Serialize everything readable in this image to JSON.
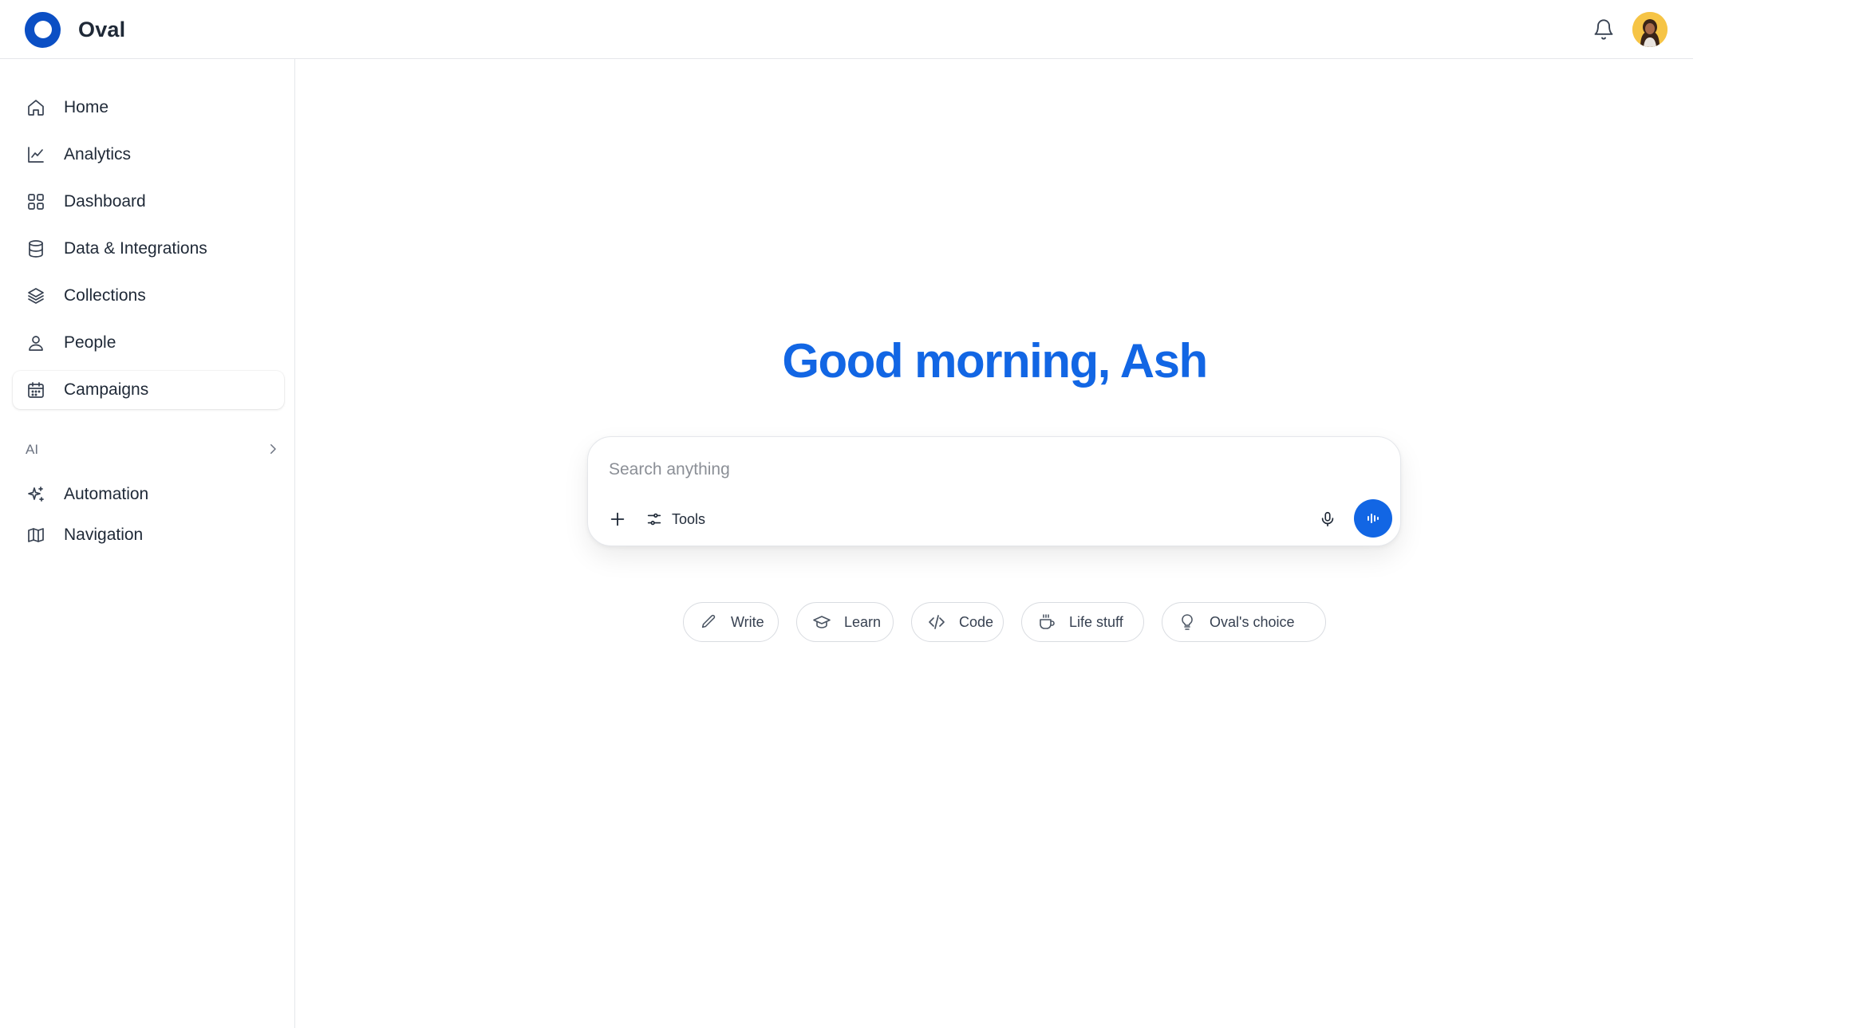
{
  "app": {
    "name": "Oval"
  },
  "sidebar": {
    "items": [
      {
        "label": "Home",
        "icon": "home-icon"
      },
      {
        "label": "Analytics",
        "icon": "chart-line-icon"
      },
      {
        "label": "Dashboard",
        "icon": "grid-icon"
      },
      {
        "label": "Data & Integrations",
        "icon": "database-icon"
      },
      {
        "label": "Collections",
        "icon": "layers-icon"
      },
      {
        "label": "People",
        "icon": "user-icon"
      },
      {
        "label": "Campaigns",
        "icon": "calendar-icon",
        "active": true
      }
    ],
    "section_label": "AI",
    "ai_items": [
      {
        "label": "Automation",
        "icon": "sparkles-icon"
      },
      {
        "label": "Navigation",
        "icon": "map-icon"
      }
    ]
  },
  "main": {
    "greeting": "Good morning, Ash",
    "search": {
      "placeholder": "Search anything",
      "value": "",
      "tools_label": "Tools"
    },
    "suggestions": [
      {
        "label": "Write",
        "icon": "pencil-icon"
      },
      {
        "label": "Learn",
        "icon": "graduation-cap-icon"
      },
      {
        "label": "Code",
        "icon": "code-icon"
      },
      {
        "label": "Life stuff",
        "icon": "coffee-cup-icon"
      },
      {
        "label": "Oval's choice",
        "icon": "lightbulb-icon"
      }
    ]
  },
  "colors": {
    "accent": "#1266e4",
    "logo": "#0b4fc4",
    "avatar_bg": "#f6c445"
  }
}
